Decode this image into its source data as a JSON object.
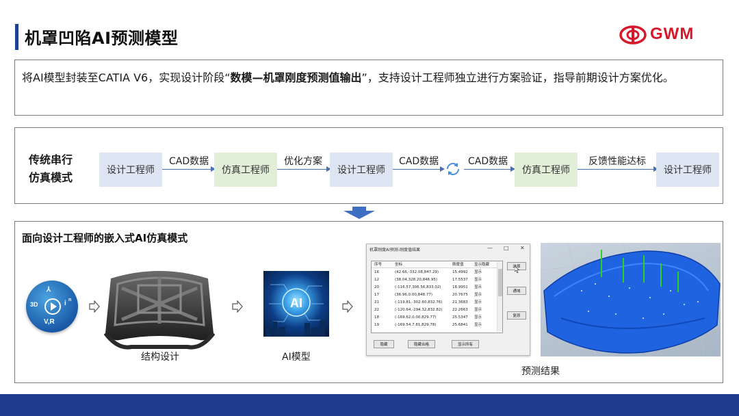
{
  "header": {
    "title": "机罩凹陷AI预测模型",
    "logo_text": "GWM",
    "brand_color": "#d7182a"
  },
  "description": {
    "before": "将AI模型封装至CATIA V6，实现设计阶段“",
    "bold": "数模—机罩刚度预测值输出",
    "after": "”，支持设计工程师独立进行方案验证，指导前期设计方案优化。"
  },
  "traditional": {
    "label_line1": "传统串行",
    "label_line2": "仿真模式",
    "nodes": [
      {
        "label": "设计工程师"
      },
      {
        "label": "仿真工程师"
      },
      {
        "label": "设计工程师"
      },
      {
        "label": "仿真工程师"
      },
      {
        "label": "设计工程师"
      }
    ],
    "edges": [
      {
        "label": "CAD数据"
      },
      {
        "label": "优化方案"
      },
      {
        "label": "CAD数据"
      },
      {
        "label": "CAD数据"
      },
      {
        "label": "反馈性能达标"
      }
    ],
    "cycle_icon": "refresh-icon"
  },
  "embedded": {
    "title": "面向设计工程师的嵌入式AI仿真模式",
    "catia_icon": {
      "label_3d": "3D",
      "label_vr": "V,R",
      "label_i": "i",
      "label_n": "n"
    },
    "captions": {
      "structure": "结构设计",
      "ai_model": "AI模型",
      "result": "预测结果"
    },
    "ai_badge": "AI",
    "window": {
      "title": "机罩刚度AI预测-刚度值结果",
      "controls": [
        "—",
        "□",
        "✕"
      ],
      "columns": [
        "序号",
        "坐标",
        "刚度值",
        "显示隐藏"
      ],
      "rows": [
        {
          "id": "16",
          "coord": "(42.66,-332.08,847.29)",
          "value": "15.4992",
          "show": "显示"
        },
        {
          "id": "12",
          "coord": "(38.04,328.20,846.95)",
          "value": "17.5537",
          "show": "显示"
        },
        {
          "id": "20",
          "coord": "(-116.57,306.56,833.02)",
          "value": "18.9951",
          "show": "显示"
        },
        {
          "id": "17",
          "coord": "(36.96,0.00,848.77)",
          "value": "20.7675",
          "show": "显示"
        },
        {
          "id": "21",
          "coord": "(-119.81,-302.60,832.76)",
          "value": "21.3683",
          "show": "显示"
        },
        {
          "id": "22",
          "coord": "(-120.64,-294.32,832.82)",
          "value": "22.2663",
          "show": "显示"
        },
        {
          "id": "18",
          "coord": "(-169.62,0.00,829.77)",
          "value": "25.5347",
          "show": "显示"
        },
        {
          "id": "19",
          "coord": "(-169.54,7.81,829.78)",
          "value": "25.6841",
          "show": "显示"
        }
      ],
      "side_buttons": [
        "选择",
        "通域",
        "复原"
      ],
      "bottom_buttons": [
        "隐藏",
        "隐藏合格",
        "显示所有"
      ]
    }
  }
}
